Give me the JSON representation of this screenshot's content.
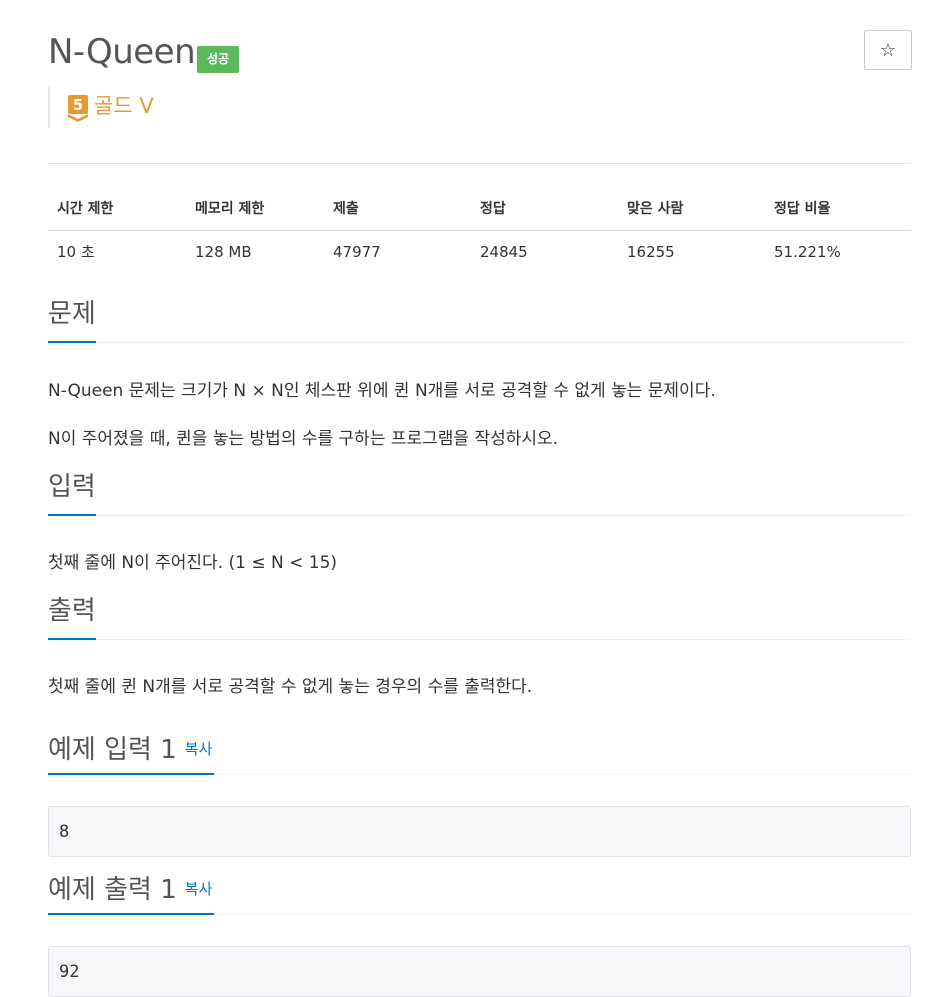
{
  "problem": {
    "title": "N-Queen",
    "result_badge": "성공",
    "star_icon": "☆",
    "tier": {
      "level": "5",
      "label": "골드 V",
      "color": "#e69a2e"
    }
  },
  "info_table": {
    "headers": [
      "시간 제한",
      "메모리 제한",
      "제출",
      "정답",
      "맞은 사람",
      "정답 비율"
    ],
    "values": [
      "10 초",
      "128 MB",
      "47977",
      "24845",
      "16255",
      "51.221%"
    ]
  },
  "sections": {
    "description": {
      "title": "문제",
      "paragraphs": [
        "N-Queen 문제는 크기가 N × N인 체스판 위에 퀸 N개를 서로 공격할 수 없게 놓는 문제이다.",
        "N이 주어졌을 때, 퀸을 놓는 방법의 수를 구하는 프로그램을 작성하시오."
      ]
    },
    "input": {
      "title": "입력",
      "text": "첫째 줄에 N이 주어진다. (1 ≤ N < 15)"
    },
    "output": {
      "title": "출력",
      "text": "첫째 줄에 퀸 N개를 서로 공격할 수 없게 놓는 경우의 수를 출력한다."
    },
    "sample_input": {
      "title": "예제 입력 1",
      "copy_label": "복사",
      "value": "8"
    },
    "sample_output": {
      "title": "예제 출력 1",
      "copy_label": "복사",
      "value": "92"
    }
  },
  "colors": {
    "accent": "#0076c0",
    "success": "#5cb85c",
    "tier_gold": "#e69a2e"
  }
}
